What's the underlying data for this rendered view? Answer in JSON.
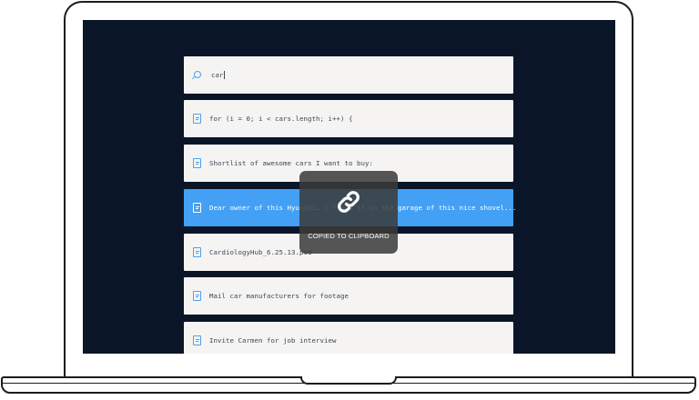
{
  "search": {
    "query": "car"
  },
  "results": [
    {
      "text": "for (i = 0; i < cars.length; i++) {",
      "icon": "document-icon",
      "selected": false
    },
    {
      "text": "Shortlist of awesome cars I want to buy:",
      "icon": "document-icon",
      "selected": false
    },
    {
      "text": "Dear owner of this Hyundai… I found it in the garage of this nice shovel...",
      "icon": "document-icon",
      "selected": true
    },
    {
      "text": "CardiologyHub_6.25.13.psd",
      "icon": "document-icon",
      "selected": false
    },
    {
      "text": "Mail car manufacturers for footage",
      "icon": "document-icon",
      "selected": false
    },
    {
      "text": "Invite Carmen for job interview",
      "icon": "document-icon",
      "selected": false
    }
  ],
  "toast": {
    "icon": "link-icon",
    "message": "COPIED TO CLIPBOARD"
  },
  "colors": {
    "screen_bg": "#0a1628",
    "row_bg": "#f5f4f3",
    "accent": "#44a0f5",
    "toast_bg": "#3a3a3a"
  }
}
